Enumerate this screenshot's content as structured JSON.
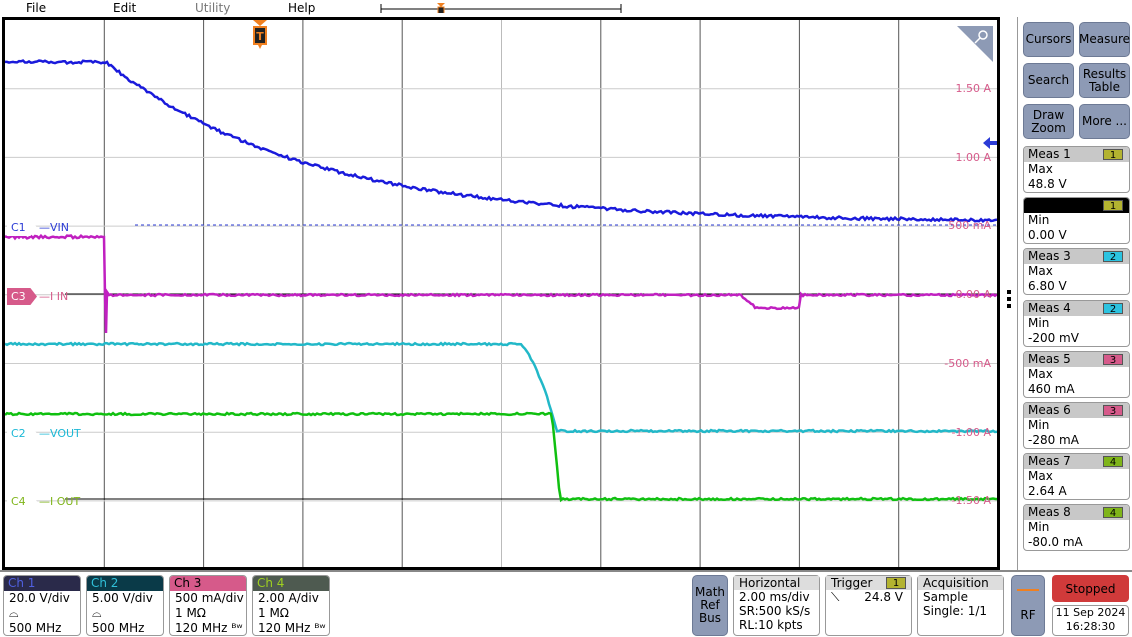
{
  "menu": {
    "file": "File",
    "edit": "Edit",
    "utility": "Utility",
    "help": "Help"
  },
  "plot": {
    "trigger_marker": "T",
    "y_labels": [
      "1.50 A",
      "1.00 A",
      "500 mA",
      "0.00 A",
      "-500 mA",
      "-1.00 A",
      "-1.50 A"
    ]
  },
  "channels_labels": [
    {
      "tag": "C1",
      "name": "VIN",
      "color": "#2b3bd6"
    },
    {
      "tag": "C3",
      "name": "I IN",
      "color": "#d65a8a"
    },
    {
      "tag": "C2",
      "name": "VOUT",
      "color": "#1cb8d6"
    },
    {
      "tag": "C4",
      "name": "I OUT",
      "color": "#7fb51a"
    }
  ],
  "trace_colors": {
    "ch1": "#1a1adb",
    "ch2": "#22b8c8",
    "ch3": "#c020c0",
    "ch4": "#10c010"
  },
  "side": {
    "cursors": "Cursors",
    "measure": "Measure",
    "search": "Search",
    "results": "Results Table",
    "draw_zoom": "Draw Zoom",
    "more": "More ..."
  },
  "measurements": [
    {
      "title": "Meas 1",
      "src": "1",
      "type": "Max",
      "value": "48.8 V",
      "color": "#b3b330"
    },
    {
      "title": "",
      "src": "1",
      "type": "Min",
      "value": "0.00 V",
      "color": "#b3b330"
    },
    {
      "title": "Meas 3",
      "src": "2",
      "type": "Max",
      "value": "6.80 V",
      "color": "#2cc3e0"
    },
    {
      "title": "Meas 4",
      "src": "2",
      "type": "Min",
      "value": "-200 mV",
      "color": "#2cc3e0"
    },
    {
      "title": "Meas 5",
      "src": "3",
      "type": "Max",
      "value": "460 mA",
      "color": "#d65a8a"
    },
    {
      "title": "Meas 6",
      "src": "3",
      "type": "Min",
      "value": "-280 mA",
      "color": "#d65a8a"
    },
    {
      "title": "Meas 7",
      "src": "4",
      "type": "Max",
      "value": "2.64 A",
      "color": "#7fb51a"
    },
    {
      "title": "Meas 8",
      "src": "4",
      "type": "Min",
      "value": "-80.0 mA",
      "color": "#7fb51a"
    }
  ],
  "channels": [
    {
      "name": "Ch 1",
      "scale": "20.0 V/div",
      "line2": "⌓",
      "bw": "500 MHz",
      "hd_bg": "#2a2a4a",
      "hd_fg": "#5060e0"
    },
    {
      "name": "Ch 2",
      "scale": "5.00 V/div",
      "line2": "⌓",
      "bw": "500 MHz",
      "hd_bg": "#0a3a48",
      "hd_fg": "#30c0d8"
    },
    {
      "name": "Ch 3",
      "scale": "500 mA/div",
      "line2": "1 MΩ",
      "bw": "120 MHz ᴮʷ",
      "hd_bg": "#d65a8a",
      "hd_fg": "#000"
    },
    {
      "name": "Ch 4",
      "scale": "2.00 A/div",
      "line2": "1 MΩ",
      "bw": "120 MHz ᴮʷ",
      "hd_bg": "#4e5a50",
      "hd_fg": "#9fd020"
    }
  ],
  "mrb": "Math Ref Bus",
  "horizontal": {
    "title": "Horizontal",
    "scale": "2.00 ms/div",
    "sr": "SR:500 kS/s",
    "rl": "RL:10 kpts"
  },
  "trigger": {
    "title": "Trigger",
    "src": "1",
    "slope": "⟍",
    "level": "24.8 V"
  },
  "acquisition": {
    "title": "Acquisition",
    "mode": "Sample",
    "single": "Single: 1/1"
  },
  "rf": "RF",
  "status": {
    "run": "Stopped",
    "date": "11 Sep 2024",
    "time": "16:28:30"
  }
}
